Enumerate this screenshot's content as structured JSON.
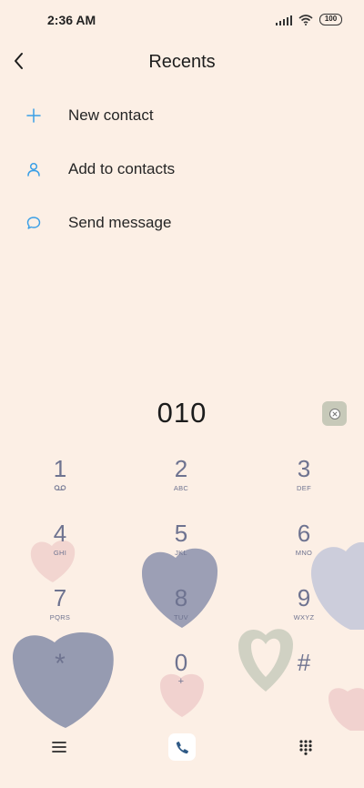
{
  "status": {
    "time": "2:36 AM",
    "battery": "100"
  },
  "header": {
    "title": "Recents"
  },
  "actions": [
    {
      "label": "New contact",
      "icon": "plus-icon"
    },
    {
      "label": "Add to contacts",
      "icon": "person-icon"
    },
    {
      "label": "Send message",
      "icon": "message-icon"
    }
  ],
  "dialer": {
    "number": "010",
    "keys": [
      {
        "digit": "1",
        "letters": ""
      },
      {
        "digit": "2",
        "letters": "ABC"
      },
      {
        "digit": "3",
        "letters": "DEF"
      },
      {
        "digit": "4",
        "letters": "GHI"
      },
      {
        "digit": "5",
        "letters": "JKL"
      },
      {
        "digit": "6",
        "letters": "MNO"
      },
      {
        "digit": "7",
        "letters": "PQRS"
      },
      {
        "digit": "8",
        "letters": "TUV"
      },
      {
        "digit": "9",
        "letters": "WXYZ"
      },
      {
        "digit": "*",
        "letters": ""
      },
      {
        "digit": "0",
        "letters": "+"
      },
      {
        "digit": "#",
        "letters": ""
      }
    ]
  },
  "colors": {
    "background": "#fcefe5",
    "accent": "#3a9fe6",
    "keypad_text": "#6e7390"
  }
}
